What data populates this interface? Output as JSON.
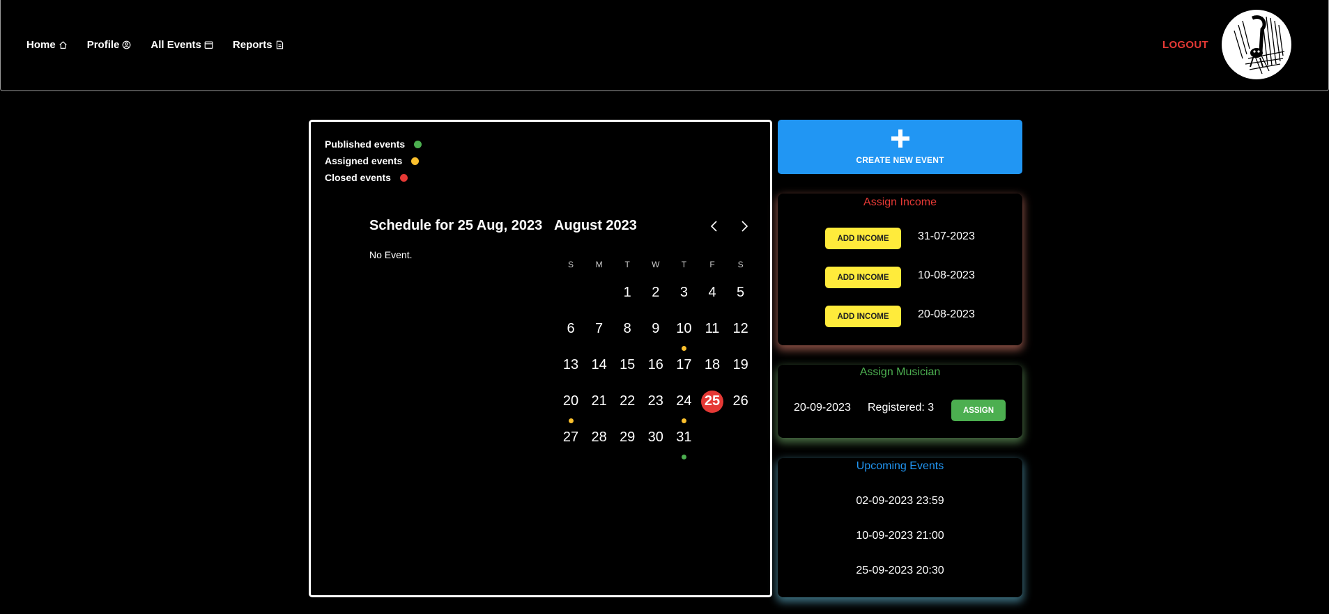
{
  "nav": {
    "items": [
      {
        "label": "Home",
        "icon": "home-icon"
      },
      {
        "label": "Profile",
        "icon": "user-circle-icon"
      },
      {
        "label": "All Events",
        "icon": "calendar-icon"
      },
      {
        "label": "Reports",
        "icon": "document-icon"
      }
    ],
    "logout_label": "LOGOUT"
  },
  "colors": {
    "published": "#4caf50",
    "assigned": "#fbc02d",
    "closed": "#e53935",
    "accent_blue": "#2196f3"
  },
  "legend": [
    {
      "label": "Published events",
      "color": "#4caf50"
    },
    {
      "label": "Assigned events",
      "color": "#fbc02d"
    },
    {
      "label": "Closed events",
      "color": "#e53935"
    }
  ],
  "calendar": {
    "schedule_title": "Schedule for 25 Aug, 2023",
    "no_event_text": "No Event.",
    "month_title": "August 2023",
    "weekdays": [
      "S",
      "M",
      "T",
      "W",
      "T",
      "F",
      "S"
    ],
    "first_weekday_index": 2,
    "days_in_month": 31,
    "selected_day": 25,
    "event_dots": [
      {
        "day": 10,
        "status": "assigned"
      },
      {
        "day": 20,
        "status": "assigned"
      },
      {
        "day": 24,
        "status": "assigned"
      },
      {
        "day": 31,
        "status": "published"
      }
    ]
  },
  "create_event": {
    "label": "CREATE NEW EVENT",
    "icon": "plus-icon"
  },
  "assign_income": {
    "title": "Assign Income",
    "button_label": "ADD INCOME",
    "dates": [
      "31-07-2023",
      "10-08-2023",
      "20-08-2023"
    ]
  },
  "assign_musician": {
    "title": "Assign Musician",
    "date": "20-09-2023",
    "registered": "Registered: 3",
    "button_label": "ASSIGN"
  },
  "upcoming": {
    "title": "Upcoming Events",
    "items": [
      "02-09-2023 23:59",
      "10-09-2023 21:00",
      "25-09-2023 20:30"
    ]
  }
}
